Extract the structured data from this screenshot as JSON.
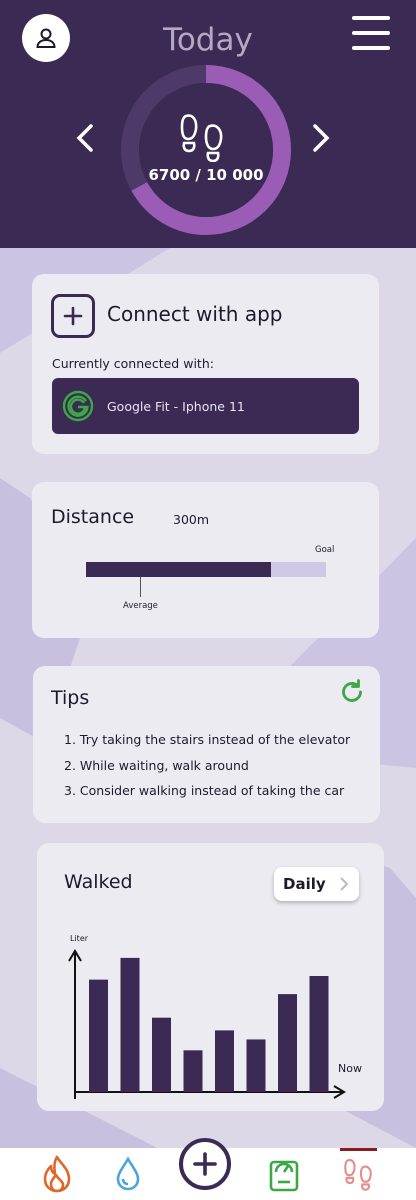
{
  "header": {
    "title": "Today",
    "steps_display": "6700 / 10 000",
    "steps_current": 6700,
    "steps_goal": 10000,
    "icons": [
      "user-icon",
      "hamburger-menu-icon",
      "chevron-left-icon",
      "chevron-right-icon",
      "footprints-icon"
    ]
  },
  "connect": {
    "title": "Connect with app",
    "currently_connected_label": "Currently connected with:",
    "app_name": "Google Fit - Iphone 11",
    "icons": [
      "plus-icon",
      "google-fit-icon"
    ]
  },
  "distance": {
    "title": "Distance",
    "value": "300m",
    "goal_label": "Goal",
    "average_label": "Average",
    "progress_fraction": 0.77,
    "average_fraction": 0.23
  },
  "tips": {
    "title": "Tips",
    "items": [
      "1. Try taking the stairs instead of the elevator",
      "2. While waiting, walk around",
      "3. Consider walking instead of taking the car"
    ],
    "icons": [
      "refresh-icon"
    ]
  },
  "walked": {
    "title": "Walked",
    "period_button": "Daily"
  },
  "chart_data": {
    "type": "bar",
    "ylabel": "Liter",
    "xlabel": "Now",
    "values": [
      62,
      74,
      41,
      23,
      34,
      29,
      54,
      64
    ],
    "ylim": [
      0,
      80
    ],
    "grid": false
  },
  "bottom_nav": {
    "items": [
      "flame-icon",
      "water-drop-icon",
      "add-icon",
      "scale-icon",
      "footprints-icon"
    ],
    "active": "footprints-icon"
  },
  "colors": {
    "brand_purple": "#3b2a54",
    "ring_accent": "#9a5cb4",
    "background": "#dcd8e8",
    "card": "#ecebf2",
    "green": "#3aa845",
    "orange": "#e0662a",
    "blue": "#4aa6d8",
    "pink": "#e88b8b"
  }
}
